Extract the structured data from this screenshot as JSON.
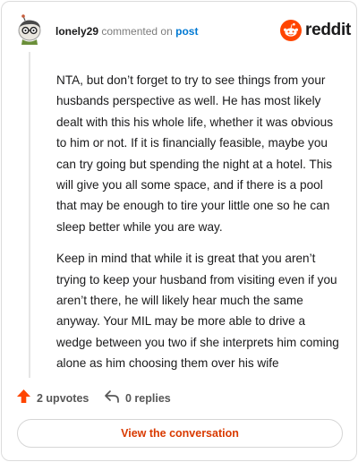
{
  "comment": {
    "username": "lonely29",
    "action_text": "commented on",
    "post_link": "post",
    "paragraphs": [
      "NTA, but don’t forget to try to see things from your husbands perspective as well. He has most likely dealt with this his whole life, whether it was obvious to him or not. If it is financially feasible, maybe you can try going but spending the night at a hotel. This will give you all some space, and if there is a pool that may be enough to tire your little one so he can sleep better while you are way.",
      "Keep in mind that while it is great that you aren’t trying to keep your husband from visiting even if you aren’t there, he will likely hear much the same anyway. Your MIL may be more able to drive a wedge between you two if she interprets him coming alone as him choosing them over his wife"
    ]
  },
  "brand": {
    "wordmark": "reddit",
    "icon": "reddit-logo-icon",
    "color": "#ff4500"
  },
  "actions": {
    "upvotes_label": "2 upvotes",
    "upvote_icon": "upvote-arrow-icon",
    "replies_label": "0 replies",
    "reply_icon": "reply-arrow-icon"
  },
  "cta": {
    "label": "View the conversation"
  },
  "colors": {
    "accent": "#ff4500",
    "cta_text": "#d93a00",
    "link": "#0079d3"
  }
}
